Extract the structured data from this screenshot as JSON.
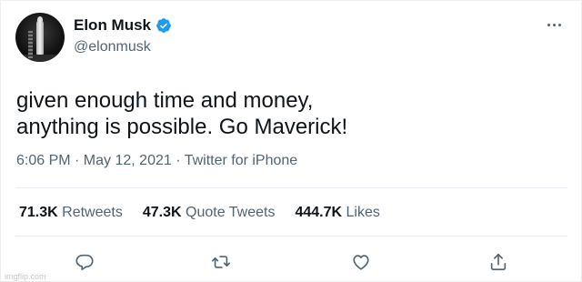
{
  "colors": {
    "text_primary": "#0f1419",
    "text_secondary": "#536471",
    "verified_badge": "#1d9bf0",
    "icon": "#536471",
    "background": "#ffffff"
  },
  "author": {
    "display_name": "Elon Musk",
    "handle": "@elonmusk",
    "verified": true,
    "avatar_icon": "avatar-rocket-photo"
  },
  "tweet": {
    "text_lines": [
      "given enough time and money,",
      "anything is possible. Go Maverick!"
    ],
    "meta": "6:06 PM · May 12, 2021 · Twitter for iPhone"
  },
  "stats": {
    "retweets": {
      "count": "71.3K",
      "label": "Retweets"
    },
    "quote_tweets": {
      "count": "47.3K",
      "label": "Quote Tweets"
    },
    "likes": {
      "count": "444.7K",
      "label": "Likes"
    }
  },
  "actions": [
    {
      "icon": "reply-icon"
    },
    {
      "icon": "retweet-icon"
    },
    {
      "icon": "like-icon"
    },
    {
      "icon": "share-icon"
    }
  ],
  "menu": {
    "icon": "more-options-icon"
  },
  "watermark": "imgflip.com"
}
